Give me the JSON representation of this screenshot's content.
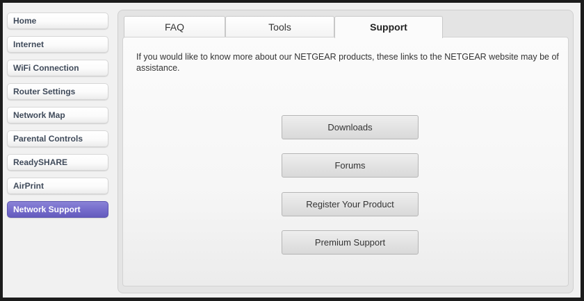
{
  "sidebar": {
    "items": [
      {
        "label": "Home",
        "active": false
      },
      {
        "label": "Internet",
        "active": false
      },
      {
        "label": "WiFi Connection",
        "active": false
      },
      {
        "label": "Router Settings",
        "active": false
      },
      {
        "label": "Network Map",
        "active": false
      },
      {
        "label": "Parental Controls",
        "active": false
      },
      {
        "label": "ReadySHARE",
        "active": false
      },
      {
        "label": "AirPrint",
        "active": false
      },
      {
        "label": "Network Support",
        "active": true
      }
    ]
  },
  "tabs": [
    {
      "label": "FAQ",
      "active": false
    },
    {
      "label": "Tools",
      "active": false
    },
    {
      "label": "Support",
      "active": true
    }
  ],
  "support": {
    "intro": "If you would like to know more about our NETGEAR products, these links to the NETGEAR website may be of assistance.",
    "buttons": [
      {
        "label": "Downloads"
      },
      {
        "label": "Forums"
      },
      {
        "label": "Register Your Product"
      },
      {
        "label": "Premium Support"
      }
    ]
  },
  "colors": {
    "active_nav": "#766dcc",
    "panel_bg": "#e4e4e4",
    "frame_border": "#1c1c1c"
  }
}
